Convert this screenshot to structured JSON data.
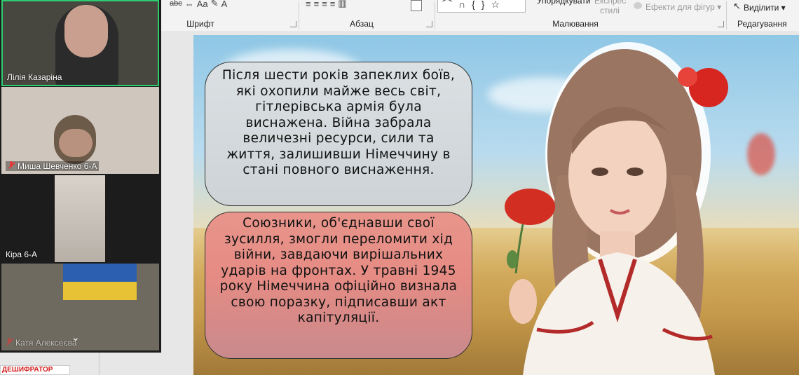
{
  "ribbon": {
    "groups": {
      "font": "Шрифт",
      "paragraph": "Абзац",
      "drawing": "Малювання",
      "editing": "Редагування"
    },
    "arrange_label": "Упорядкувати",
    "express_styles_line1": "Експрес",
    "express_styles_line2": "стилі",
    "shape_effects_label": "Ефекти для фігур",
    "select_label": "Виділити"
  },
  "participants": [
    {
      "name": "Лілія Казаріна",
      "muted": false,
      "active_speaker": true
    },
    {
      "name": "Миша Шевченко 6-А",
      "muted": true,
      "active_speaker": false
    },
    {
      "name": "Кіра 6-А",
      "muted": false,
      "active_speaker": false
    },
    {
      "name": "Катя Алексеєва",
      "muted": true,
      "active_speaker": false
    }
  ],
  "thumbnail_label": "ДЕШИФРАТОР",
  "slide": {
    "text_block_1": "Після шести років запеклих боїв, які охопили майже весь світ, гітлерівська армія була виснажена. Війна забрала величезні ресурси, сили та життя, залишивши Німеччину в стані повного виснаження.",
    "text_block_2": "Союзники, об'єднавши свої зусилля, змогли переломити хід війни, завдаючи вирішальних ударів на фронтах. У травні 1945 року Німеччина офіційно визнала свою поразку, підписавши акт капітуляції."
  },
  "colors": {
    "active_speaker_border": "#2ecc71",
    "muted_icon": "#e03a3a",
    "thumbnail_text": "#d41b1b"
  }
}
